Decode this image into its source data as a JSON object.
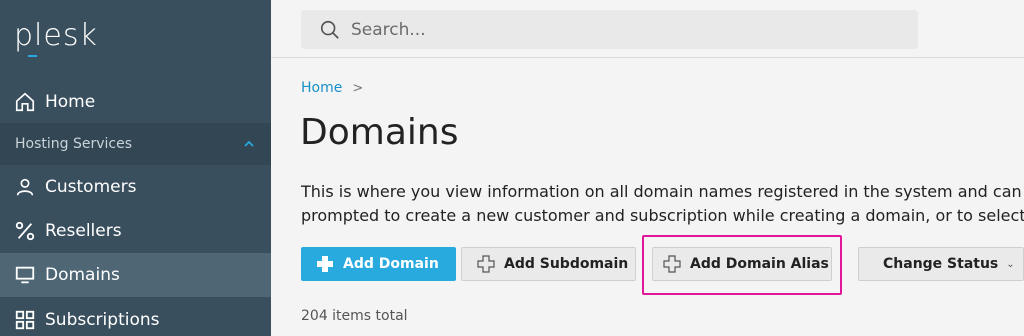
{
  "sidebar": {
    "logo": "plesk",
    "home": {
      "label": "Home",
      "icon": "home-icon"
    },
    "section": {
      "label": "Hosting Services",
      "icon": "chevron-up-icon"
    },
    "items": [
      {
        "label": "Customers",
        "icon": "user-icon"
      },
      {
        "label": "Resellers",
        "icon": "percent-icon"
      },
      {
        "label": "Domains",
        "icon": "monitor-icon",
        "active": true
      },
      {
        "label": "Subscriptions",
        "icon": "grid-icon"
      }
    ]
  },
  "search": {
    "placeholder": "Search...",
    "icon": "search-icon"
  },
  "breadcrumb": {
    "home": "Home",
    "separator": ">"
  },
  "page": {
    "title": "Domains",
    "description_line1": "This is where you view information on all domain names registered in the system and can",
    "description_line2": "prompted to create a new customer and subscription while creating a domain, or to select"
  },
  "toolbar": {
    "add_domain": "Add Domain",
    "add_subdomain": "Add Subdomain",
    "add_domain_alias": "Add Domain Alias",
    "change_status": "Change Status",
    "change_status_caret": "⌄"
  },
  "list": {
    "count_text": "204 items total"
  },
  "colors": {
    "accent": "#28aade",
    "sidebar": "#3a4f5e",
    "highlight": "#e0169b"
  }
}
